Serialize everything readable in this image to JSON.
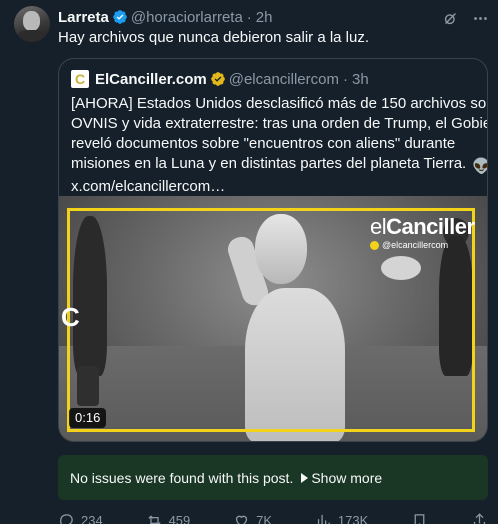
{
  "post": {
    "author_name": "Larreta",
    "author_handle": "@horaciorlarreta",
    "time": "2h",
    "text": "Hay archivos que nunca debieron salir a la luz."
  },
  "quote": {
    "author_name": "ElCanciller.com",
    "author_handle": "@elcancillercom",
    "time": "3h",
    "lines": [
      "[AHORA] Estados Unidos desclasificó más de 150 archivos sobre",
      "OVNIS y vida extraterrestre: tras una orden de Trump, el Gobierno",
      "reveló documentos sobre \"encuentros con aliens\" durante",
      "misiones en la Luna y en distintas partes del planeta Tierra."
    ],
    "emojis": "👽🛸",
    "link": "x.com/elcancillercom…",
    "media": {
      "watermark_light": "el",
      "watermark_bold": "Canciller",
      "watermark_handle": "@elcancillercom",
      "corner_logo": "C",
      "duration": "0:16"
    }
  },
  "notice": {
    "text": "No issues were found with this post.",
    "show_more": "Show more"
  },
  "actions": {
    "replies": "234",
    "reposts": "459",
    "likes": "7K",
    "views": "173K"
  },
  "colors": {
    "background": "#15202b",
    "text": "#f7f9f9",
    "muted": "#8b98a5",
    "verified_blue": "#1d9bf0",
    "verified_gold": "#e2b719",
    "notice_bg": "#1a3624",
    "frame_yellow": "#f2d31a"
  },
  "icons": {
    "verified": "verified-badge-icon",
    "grok": "grok-icon",
    "more": "more-icon",
    "reply": "reply-icon",
    "repost": "repost-icon",
    "like": "heart-icon",
    "views": "views-icon",
    "bookmark": "bookmark-icon",
    "share": "share-icon"
  }
}
